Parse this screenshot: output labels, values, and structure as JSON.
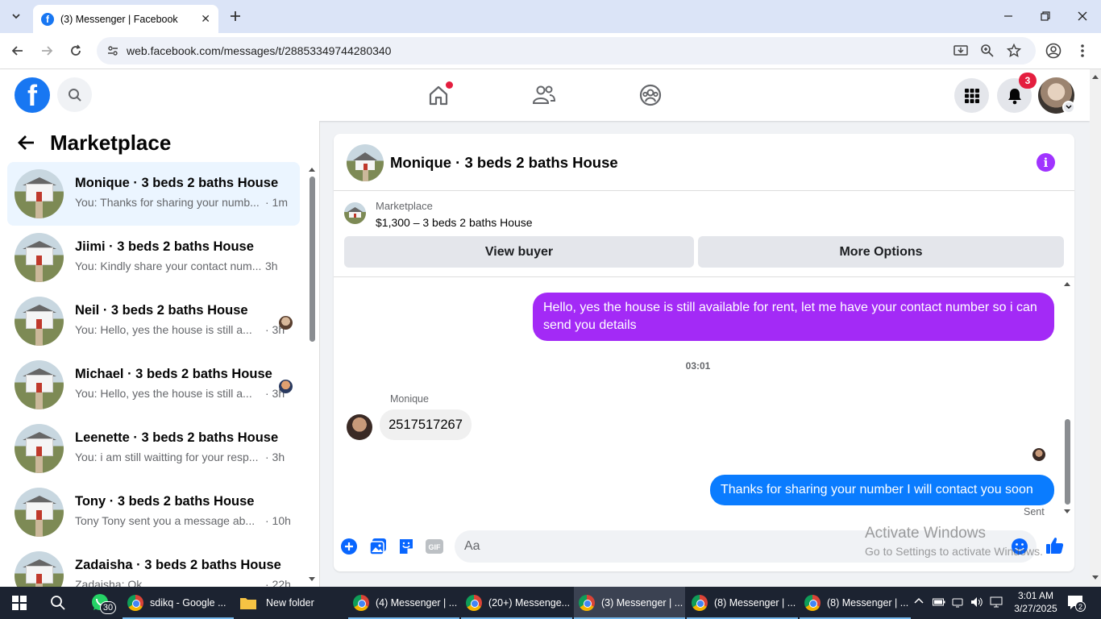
{
  "browser": {
    "tab_title": "(3) Messenger | Facebook",
    "url": "web.facebook.com/messages/t/28853349744280340"
  },
  "header": {
    "notifications_count": "3"
  },
  "left_panel": {
    "title": "Marketplace",
    "conversations": [
      {
        "name": "Monique · 3 beds 2 baths House",
        "snippet": "You: Thanks for sharing your numb...",
        "time": "· 1m",
        "active": true
      },
      {
        "name": "Jiimi · 3 beds 2 baths House",
        "snippet": "You: Kindly share your contact num...",
        "time": "3h"
      },
      {
        "name": "Neil · 3 beds 2 baths House",
        "snippet": "You: Hello, yes the house is still a...",
        "time": "· 3h"
      },
      {
        "name": "Michael · 3 beds 2 baths House",
        "snippet": "You: Hello, yes the house is still a...",
        "time": "· 3h"
      },
      {
        "name": "Leenette · 3 beds 2 baths House",
        "snippet": "You: i am still waitting for your resp...",
        "time": "· 3h"
      },
      {
        "name": "Tony · 3 beds 2 baths House",
        "snippet": "Tony Tony sent you a message ab...",
        "time": "· 10h"
      },
      {
        "name": "Zadaisha · 3 beds 2 baths House",
        "snippet": "Zadaisha: Ok",
        "time": "· 22h"
      }
    ]
  },
  "chat": {
    "title": "Monique · 3 beds 2 baths House",
    "listing_label": "Marketplace",
    "listing_price": "$1,300 – 3 beds 2 baths House",
    "view_buyer": "View buyer",
    "more_options": "More Options",
    "messages": {
      "outgoing_1": "Hello, yes the house is still available for rent, let me have your contact number so i can send you  details",
      "timestamp": "03:01",
      "sender": "Monique",
      "incoming": "2517517267",
      "outgoing_2": "Thanks for sharing your number I will contact you soon",
      "status": "Sent"
    },
    "composer_placeholder": "Aa"
  },
  "watermark": {
    "line1": "Activate Windows",
    "line2": "Go to Settings to activate Windows."
  },
  "taskbar": {
    "whatsapp_count": "30",
    "items": [
      {
        "label": "sdikq - Google ..."
      },
      {
        "label": "New folder"
      },
      {
        "label": "(4) Messenger | ..."
      },
      {
        "label": "(20+) Messenge..."
      },
      {
        "label": "(3) Messenger | ..."
      },
      {
        "label": "(8) Messenger | ..."
      },
      {
        "label": "(8) Messenger | ..."
      }
    ],
    "time": "3:01 AM",
    "date": "3/27/2025",
    "notification_count": "2"
  },
  "colors": {
    "facebook_blue": "#1877f2",
    "outgoing_purple": "#a32af6",
    "outgoing_blue": "#0a7cff",
    "badge_red": "#e41e3f"
  }
}
